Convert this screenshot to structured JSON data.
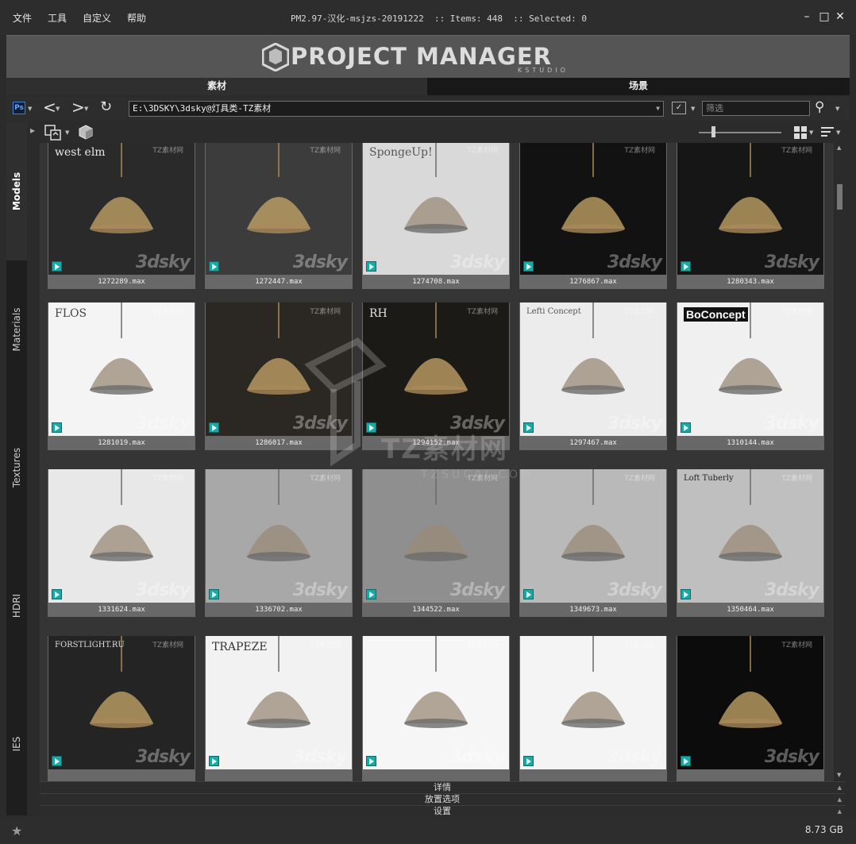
{
  "menu": {
    "file": "文件",
    "tools": "工具",
    "custom": "自定义",
    "help": "帮助"
  },
  "window": {
    "info": "PM2.97-汉化-msjzs-20191222  :: Items: 448  :: Selected: 0"
  },
  "banner": {
    "title": "PROJECT MANAGER",
    "subtitle": "KSTUDIO"
  },
  "tabs": {
    "materials": "素材",
    "scenes": "场景"
  },
  "path": {
    "value": "E:\\3DSKY\\3dsky@灯具类-TZ素材",
    "filter_placeholder": "筛选"
  },
  "sidebar": [
    {
      "label": "Models",
      "active": true
    },
    {
      "label": "Materials",
      "active": false
    },
    {
      "label": "Textures",
      "active": false
    },
    {
      "label": "HDRI",
      "active": false
    },
    {
      "label": "IES",
      "active": false
    }
  ],
  "items": [
    {
      "caption": "1272289.max",
      "bg": "#2a2a2a",
      "label": "west elm",
      "label_color": "#e8e8e8"
    },
    {
      "caption": "1272447.max",
      "bg": "#3c3c3c",
      "label": "",
      "label_color": ""
    },
    {
      "caption": "1274708.max",
      "bg": "#d9d9d9",
      "label": "SpongeUp!",
      "label_color": "#555555"
    },
    {
      "caption": "1276867.max",
      "bg": "#121212",
      "label": "",
      "label_color": ""
    },
    {
      "caption": "1280343.max",
      "bg": "#161616",
      "label": "",
      "label_color": ""
    },
    {
      "caption": "1281019.max",
      "bg": "#f4f4f4",
      "label": "FLOS",
      "label_color": "#444444"
    },
    {
      "caption": "1286017.max",
      "bg": "#2b2722",
      "label": "",
      "label_color": ""
    },
    {
      "caption": "1294152.max",
      "bg": "#1c1a16",
      "label": "RH",
      "label_color": "#e0e0e0"
    },
    {
      "caption": "1297467.max",
      "bg": "#ececec",
      "label": "Lefti Concept",
      "label_color": "#555555"
    },
    {
      "caption": "1310144.max",
      "bg": "#f0f0f0",
      "label": "BoConcept",
      "label_color": "#ffffff"
    },
    {
      "caption": "1331624.max",
      "bg": "#e8e8e8",
      "label": "",
      "label_color": ""
    },
    {
      "caption": "1336702.max",
      "bg": "#a8a8a8",
      "label": "",
      "label_color": ""
    },
    {
      "caption": "1344522.max",
      "bg": "#8f8f8f",
      "label": "",
      "label_color": ""
    },
    {
      "caption": "1349673.max",
      "bg": "#b9b9b9",
      "label": "",
      "label_color": ""
    },
    {
      "caption": "1350464.max",
      "bg": "#bfbfbf",
      "label": "Loft Tuberly",
      "label_color": "#222222"
    },
    {
      "caption": "",
      "bg": "#242424",
      "label": "FORSTLIGHT.RU",
      "label_color": "#dddddd"
    },
    {
      "caption": "",
      "bg": "#f2f2f2",
      "label": "TRAPEZE",
      "label_color": "#333333"
    },
    {
      "caption": "",
      "bg": "#f6f6f6",
      "label": "",
      "label_color": ""
    },
    {
      "caption": "",
      "bg": "#f4f4f4",
      "label": "",
      "label_color": ""
    },
    {
      "caption": "",
      "bg": "#0c0c0c",
      "label": "",
      "label_color": ""
    }
  ],
  "thumb_watermarks": {
    "sky": "3dsky",
    "tz": "TZ素材网"
  },
  "watermark": {
    "big": "TZ素材网",
    "url": "TZSUCAI.COM"
  },
  "panels": {
    "details": "详情",
    "placement": "放置选项",
    "settings": "设置"
  },
  "status": {
    "disk": "8.73 GB"
  },
  "colors": {
    "max_badge": "#1aa9a4",
    "banner": "#555555"
  }
}
